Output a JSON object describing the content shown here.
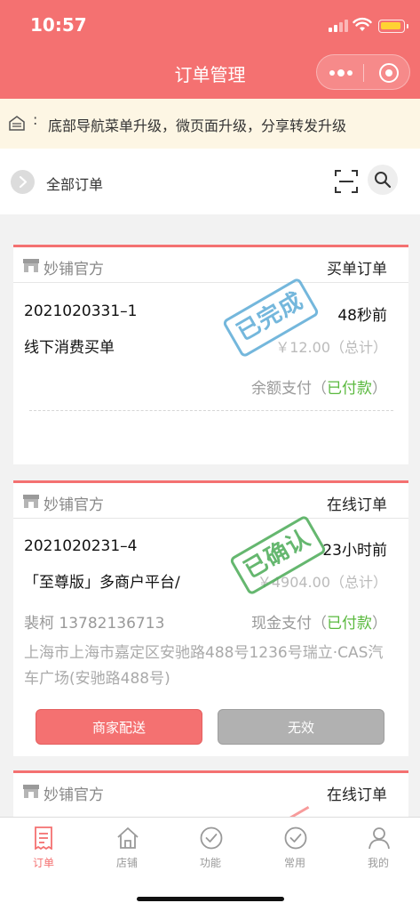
{
  "status_bar": {
    "time": "10:57"
  },
  "header": {
    "title": "订单管理"
  },
  "notice": {
    "separator": ":",
    "text": "底部导航菜单升级，微页面升级，分享转发升级"
  },
  "toolbar": {
    "label": "全部订单"
  },
  "colors": {
    "brand": "#f47171",
    "paid": "#5ab93e",
    "stamp_blue": "#5caad6",
    "stamp_green": "#4aaa56"
  },
  "orders": [
    {
      "shop": "妙铺官方",
      "type": "买单订单",
      "order_no": "2021020331–1",
      "time_ago": "48秒前",
      "item": "线下消费买单",
      "price": "￥12.00（总计）",
      "pay_method": "余额支付（",
      "pay_status": "已付款",
      "pay_close": "）",
      "stamp": "已完成"
    },
    {
      "shop": "妙铺官方",
      "type": "在线订单",
      "order_no": "2021020231–4",
      "time_ago": "23小时前",
      "item": "「至尊版」多商户平台/",
      "price": "￥4904.00（总计）",
      "buyer": "裴柯 13782136713",
      "pay_method": "现金支付（",
      "pay_status": "已付款",
      "pay_close": "）",
      "address": "上海市上海市嘉定区安驰路488号1236号瑞立·CAS汽车广场(安驰路488号)",
      "stamp": "已确认",
      "buttons": {
        "deliver": "商家配送",
        "invalid": "无效"
      }
    },
    {
      "shop": "妙铺官方",
      "type": "在线订单"
    }
  ],
  "tabbar": [
    {
      "label": "订单",
      "icon": "order-icon"
    },
    {
      "label": "店铺",
      "icon": "store-icon"
    },
    {
      "label": "功能",
      "icon": "check-circle-icon"
    },
    {
      "label": "常用",
      "icon": "check-circle-icon"
    },
    {
      "label": "我的",
      "icon": "person-icon"
    }
  ]
}
